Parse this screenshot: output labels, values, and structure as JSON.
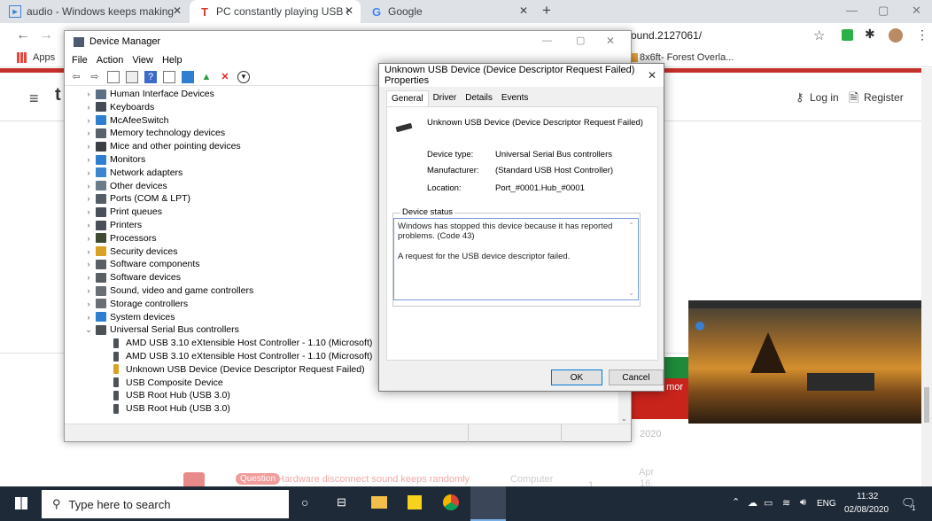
{
  "browser": {
    "tabs": [
      {
        "label": "audio - Windows keeps making t",
        "close": "✕"
      },
      {
        "label": "PC constantly playing USB devic",
        "close": "✕"
      },
      {
        "label": "Google",
        "close": "✕"
      }
    ],
    "new_tab": "+",
    "address_fragment": "ound.2127061/",
    "bookmarks": {
      "apps_label": "Apps",
      "item_label": "8x6ft- Forest Overla..."
    }
  },
  "webpage": {
    "logo_fragment": "t",
    "login_label": "Log in",
    "register_label": "Register",
    "ad_text": "t mor",
    "date_fragment": "2020",
    "question_badge": "Question",
    "question_title": "Hardware disconnect sound keeps randomly",
    "category": "Computer",
    "count": "1",
    "date_month": "Apr",
    "date_day": "16,"
  },
  "device_manager": {
    "title": "Device Manager",
    "menu": [
      "File",
      "Action",
      "View",
      "Help"
    ],
    "tree": [
      {
        "label": "Human Interface Devices",
        "icon": "hid-icon",
        "color": "#5b6f86",
        "expander": "›"
      },
      {
        "label": "Keyboards",
        "icon": "keyboard-icon",
        "color": "#444b55",
        "expander": "›"
      },
      {
        "label": "McAfeeSwitch",
        "icon": "monitor-icon",
        "color": "#2f7fd1",
        "expander": "›"
      },
      {
        "label": "Memory technology devices",
        "icon": "memory-icon",
        "color": "#59616b",
        "expander": "›"
      },
      {
        "label": "Mice and other pointing devices",
        "icon": "mouse-icon",
        "color": "#3b3f45",
        "expander": "›"
      },
      {
        "label": "Monitors",
        "icon": "monitor-icon",
        "color": "#2f7fd1",
        "expander": "›"
      },
      {
        "label": "Network adapters",
        "icon": "network-icon",
        "color": "#3a86cf",
        "expander": "›"
      },
      {
        "label": "Other devices",
        "icon": "unknown-device-icon",
        "color": "#6c7b8a",
        "expander": "›"
      },
      {
        "label": "Ports (COM & LPT)",
        "icon": "port-icon",
        "color": "#555e68",
        "expander": "›"
      },
      {
        "label": "Print queues",
        "icon": "printer-icon",
        "color": "#49505a",
        "expander": "›"
      },
      {
        "label": "Printers",
        "icon": "printer-icon",
        "color": "#49505a",
        "expander": "›"
      },
      {
        "label": "Processors",
        "icon": "processor-icon",
        "color": "#3f4a33",
        "expander": "›"
      },
      {
        "label": "Security devices",
        "icon": "security-icon",
        "color": "#d9a223",
        "expander": "›"
      },
      {
        "label": "Software components",
        "icon": "software-component-icon",
        "color": "#5a5f66",
        "expander": "›"
      },
      {
        "label": "Software devices",
        "icon": "software-device-icon",
        "color": "#5a5f66",
        "expander": "›"
      },
      {
        "label": "Sound, video and game controllers",
        "icon": "speaker-icon",
        "color": "#6a6f76",
        "expander": "›"
      },
      {
        "label": "Storage controllers",
        "icon": "storage-icon",
        "color": "#6a6f76",
        "expander": "›"
      },
      {
        "label": "System devices",
        "icon": "folder-icon",
        "color": "#2f7fd1",
        "expander": "›"
      },
      {
        "label": "Universal Serial Bus controllers",
        "icon": "usb-icon",
        "color": "#4c5258",
        "expander": "⌄"
      },
      {
        "label": "AMD USB 3.10 eXtensible Host Controller - 1.10 (Microsoft)",
        "icon": "usb-icon",
        "color": "#4c5258"
      },
      {
        "label": "AMD USB 3.10 eXtensible Host Controller - 1.10 (Microsoft)",
        "icon": "usb-icon",
        "color": "#4c5258"
      },
      {
        "label": "Unknown USB Device (Device Descriptor Request Failed)",
        "icon": "warning-usb-icon",
        "color": "#d9a223"
      },
      {
        "label": "USB Composite Device",
        "icon": "usb-icon",
        "color": "#4c5258"
      },
      {
        "label": "USB Root Hub (USB 3.0)",
        "icon": "usb-icon",
        "color": "#4c5258"
      },
      {
        "label": "USB Root Hub (USB 3.0)",
        "icon": "usb-icon",
        "color": "#4c5258"
      }
    ]
  },
  "properties": {
    "title": "Unknown USB Device (Device Descriptor Request Failed) Properties",
    "close": "✕",
    "tabs": [
      "General",
      "Driver",
      "Details",
      "Events"
    ],
    "device_name": "Unknown USB Device (Device Descriptor Request Failed)",
    "rows": [
      {
        "key": "Device type:",
        "value": "Universal Serial Bus controllers"
      },
      {
        "key": "Manufacturer:",
        "value": "(Standard USB Host Controller)"
      },
      {
        "key": "Location:",
        "value": "Port_#0001.Hub_#0001"
      }
    ],
    "status_group_label": "Device status",
    "status_line1": "Windows has stopped this device because it has reported problems. (Code 43)",
    "status_line2": "A request for the USB device descriptor failed.",
    "ok_label": "OK",
    "cancel_label": "Cancel"
  },
  "taskbar": {
    "search_placeholder": "Type here to search",
    "language": "ENG",
    "time": "11:32",
    "date": "02/08/2020",
    "notifications": "1"
  }
}
